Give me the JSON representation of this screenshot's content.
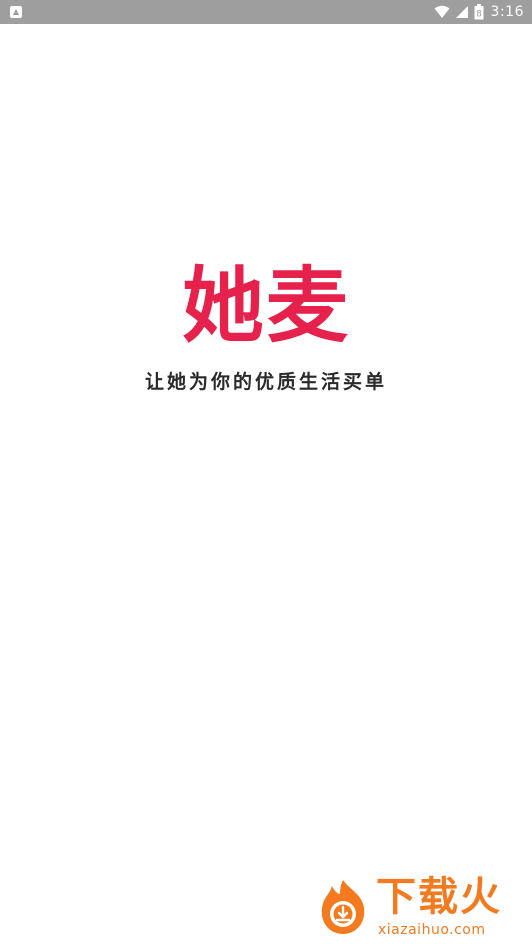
{
  "status_bar": {
    "time": "3:16",
    "battery_level": "8",
    "icons": [
      "notification-icon",
      "wifi-icon",
      "cell-signal-icon",
      "battery-icon"
    ]
  },
  "splash": {
    "logo_text": "她麦",
    "slogan": "让她为你的优质生活买单",
    "brand_color": "#e6214b"
  },
  "watermark": {
    "title": "下载火",
    "url": "xiazaihuo.com",
    "color": "#f47a20"
  }
}
